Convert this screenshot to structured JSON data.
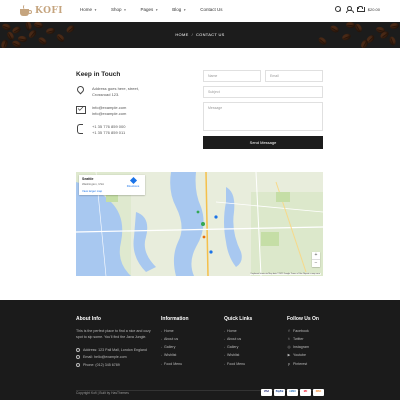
{
  "brand": {
    "name": "KOFI"
  },
  "nav": {
    "items": [
      {
        "label": "Home"
      },
      {
        "label": "Shop"
      },
      {
        "label": "Pages"
      },
      {
        "label": "Blog"
      },
      {
        "label": "Contact Us"
      }
    ],
    "cart_amount": "$20.00"
  },
  "breadcrumb": {
    "home": "HOME",
    "separator": "/",
    "current": "CONTACT US"
  },
  "contact": {
    "title": "Keep in Touch",
    "address_line1": "Address goes here, street,",
    "address_line2": "Crossroad 123.",
    "email1": "info@example.com",
    "email2": "info@example.com",
    "phone1": "+1 35 776 859 000",
    "phone2": "+1 35 776 859 011"
  },
  "form": {
    "name_placeholder": "Name",
    "email_placeholder": "Email",
    "subject_placeholder": "Subject",
    "message_placeholder": "Message",
    "submit_label": "Send Message"
  },
  "map": {
    "place_title": "Seattle",
    "place_subtitle": "Washington, USA",
    "larger_map_link": "View larger map",
    "directions_label": "Directions",
    "zoom_in": "+",
    "zoom_out": "−",
    "attribution": "Keyboard shortcuts   Map data ©2022 Google   Terms of Use   Report a map error"
  },
  "footer": {
    "about": {
      "title": "About Info",
      "text": "This is the perfect place to find a nice and cozy spot to sip some. You'll find the Java Jungle.",
      "address": "Address: 123 Pall Mall, London England",
      "email": "Email: hello@example.com",
      "phone": "Phone: (012) 345 6789"
    },
    "information": {
      "title": "Information",
      "links": [
        "Home",
        "About us",
        "Gallery",
        "Wishlist",
        "Food Menu"
      ]
    },
    "quick_links": {
      "title": "Quick Links",
      "links": [
        "Home",
        "About us",
        "Gallery",
        "Wishlist",
        "Food Menu"
      ]
    },
    "follow": {
      "title": "Follow Us On",
      "links": [
        {
          "icon": "facebook-icon",
          "glyph": "f",
          "label": "Facebook"
        },
        {
          "icon": "twitter-icon",
          "glyph": "t",
          "label": "Twitter"
        },
        {
          "icon": "instagram-icon",
          "glyph": "◎",
          "label": "Instagram"
        },
        {
          "icon": "youtube-icon",
          "glyph": "▶",
          "label": "Youtube"
        },
        {
          "icon": "pinterest-icon",
          "glyph": "p",
          "label": "Pinterest"
        }
      ]
    },
    "copyright": "Copyright Kofi | Built by HasThemes",
    "payments": [
      "VISA",
      "PayPal",
      "AMEX",
      "MC",
      "DISC"
    ]
  }
}
